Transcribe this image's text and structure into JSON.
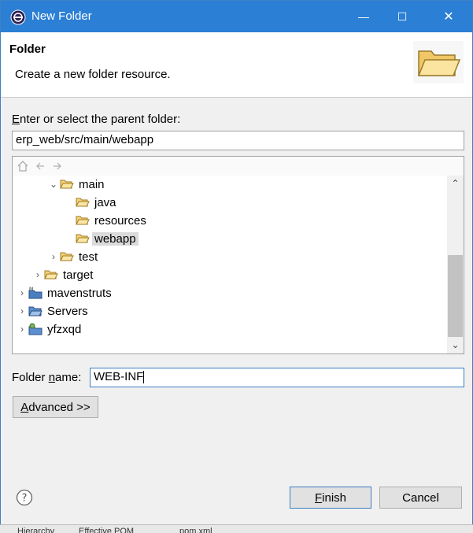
{
  "window": {
    "title": "New Folder",
    "minimize_glyph": "—",
    "maximize_glyph": "☐",
    "close_glyph": "✕"
  },
  "header": {
    "title": "Folder",
    "description": "Create a new folder resource."
  },
  "parent": {
    "label_mnemonic": "E",
    "label_rest": "nter or select the parent folder:",
    "value": "erp_web/src/main/webapp"
  },
  "tree": {
    "toolbar_icons": [
      "home-icon",
      "back-icon",
      "forward-icon"
    ],
    "items": [
      {
        "label": "main",
        "expanded": true
      },
      {
        "label": "java"
      },
      {
        "label": "resources"
      },
      {
        "label": "webapp",
        "selected": true
      },
      {
        "label": "test",
        "expanded": false
      },
      {
        "label": "target",
        "expanded": false
      },
      {
        "label": "mavenstruts",
        "expanded": false
      },
      {
        "label": "Servers",
        "expanded": false
      },
      {
        "label": "yfzxqd",
        "expanded": false
      }
    ]
  },
  "folder_name": {
    "label_before": "Folder ",
    "label_mnemonic": "n",
    "label_after": "ame:",
    "value": "WEB-INF"
  },
  "buttons": {
    "advanced_mnemonic": "A",
    "advanced_rest": "dvanced >>",
    "finish_mnemonic": "F",
    "finish_rest": "inish",
    "cancel": "Cancel"
  },
  "background_tabs": [
    "Hierarchy",
    "Effective POM",
    "pom.xml"
  ],
  "colors": {
    "titlebar": "#2b7fd4",
    "folder": "#e8b84a",
    "selection": "#dadada"
  }
}
